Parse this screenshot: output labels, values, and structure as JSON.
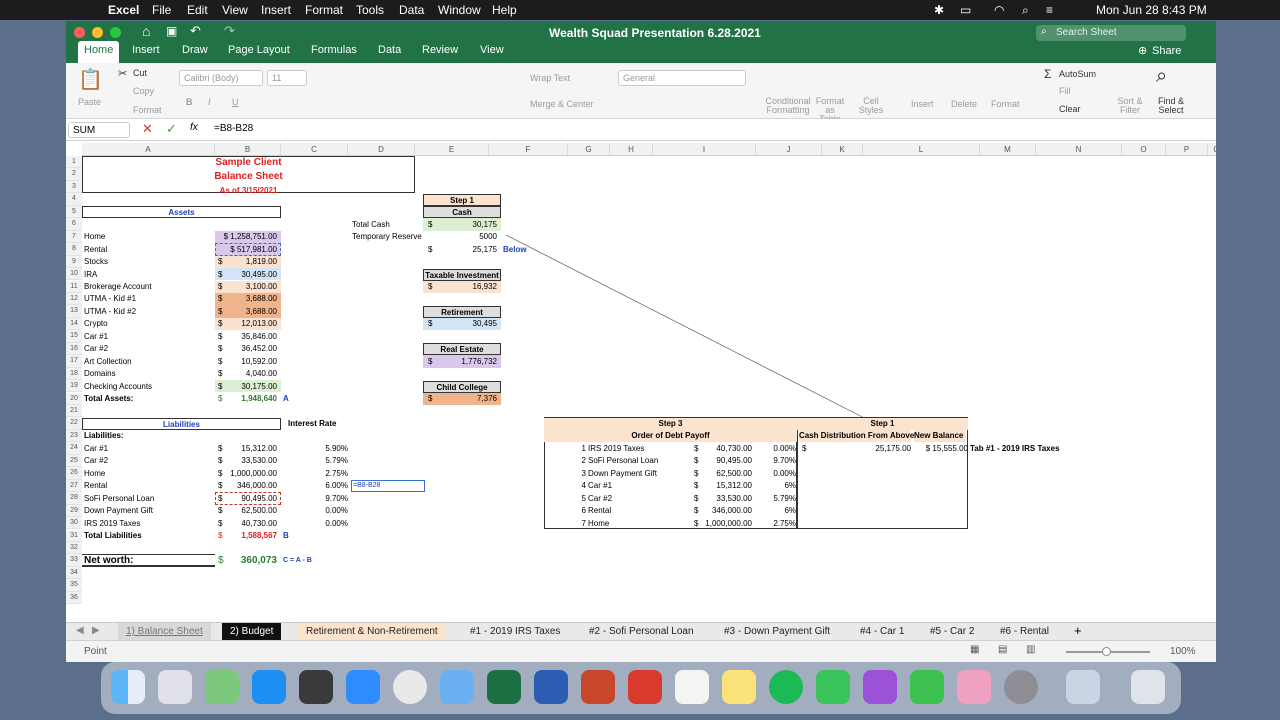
{
  "menubar": {
    "app": "Excel",
    "items": [
      "File",
      "Edit",
      "View",
      "Insert",
      "Format",
      "Tools",
      "Data",
      "Window",
      "Help"
    ],
    "clock": "Mon Jun 28  8:43 PM"
  },
  "window": {
    "title": "Wealth Squad Presentation 6.28.2021",
    "search_placeholder": "Search Sheet",
    "share": "Share"
  },
  "ribbon": {
    "tabs": [
      "Home",
      "Insert",
      "Draw",
      "Page Layout",
      "Formulas",
      "Data",
      "Review",
      "View"
    ],
    "paste": "Paste",
    "cut": "Cut",
    "copy": "Copy",
    "format": "Format",
    "font": "Calibri (Body)",
    "size": "11",
    "wrap": "Wrap Text",
    "merge": "Merge & Center",
    "numfmt": "General",
    "condfmt": "Conditional Formatting",
    "fmttable": "Format as Table",
    "cellstyles": "Cell Styles",
    "insert": "Insert",
    "delete": "Delete",
    "formatc": "Format",
    "autosum": "AutoSum",
    "fill": "Fill",
    "clear": "Clear",
    "sort": "Sort & Filter",
    "find": "Find & Select"
  },
  "formula": {
    "namebox": "SUM",
    "content": "=B8-B28"
  },
  "columns": [
    "A",
    "B",
    "C",
    "D",
    "E",
    "F",
    "G",
    "H",
    "I",
    "J",
    "K",
    "L",
    "M",
    "N",
    "O",
    "P",
    "Q"
  ],
  "header": {
    "line1": "Sample Client",
    "line2": "Balance Sheet",
    "line3": "As of 3/15/2021"
  },
  "assets_title": "Assets",
  "assets": [
    [
      "Home",
      "$ 1,258,751.00"
    ],
    [
      "Rental",
      "$   517,981.00"
    ],
    [
      "Stocks",
      "1,819.00"
    ],
    [
      "IRA",
      "30,495.00"
    ],
    [
      "Brokerage Account",
      "3,100.00"
    ],
    [
      "UTMA - Kid #1",
      "3,688.00"
    ],
    [
      "UTMA - Kid #2",
      "3,688.00"
    ],
    [
      "Crypto",
      "12,013.00"
    ],
    [
      "Car #1",
      "35,846.00"
    ],
    [
      "Car #2",
      "36,452.00"
    ],
    [
      "Art Collection",
      "10,592.00"
    ],
    [
      "Domains",
      "4,040.00"
    ],
    [
      "Checking Accounts",
      "30,175.00"
    ]
  ],
  "total_assets": {
    "label": "Total Assets:",
    "value": "1,948,640",
    "tag": "A"
  },
  "liab_title": "Liabilities",
  "interest_title": "Interest Rate",
  "liab_label": "Liabilities:",
  "liabilities": [
    [
      "Car #1",
      "15,312.00",
      "5.90%"
    ],
    [
      "Car #2",
      "33,530.00",
      "5.79%"
    ],
    [
      "Home",
      "1,000,000.00",
      "2.75%"
    ],
    [
      "Rental",
      "346,000.00",
      "6.00%"
    ],
    [
      "SoFi Personal Loan",
      "90,495.00",
      "9.70%"
    ],
    [
      "Down Payment Gift",
      "62,500.00",
      "0.00%"
    ],
    [
      "IRS 2019 Taxes",
      "40,730.00",
      "0.00%"
    ]
  ],
  "editing_cell": "=B8-B28",
  "total_liab": {
    "label": "Total Liabilities",
    "value": "1,588,567",
    "tag": "B"
  },
  "networth": {
    "label": "Net worth:",
    "value": "360,073",
    "tag": "C = A - B"
  },
  "cash": {
    "total_label": "Total Cash",
    "reserve_label": "Temporary Reserve",
    "step1": "Step 1",
    "cash": "Cash",
    "total": "30,175",
    "reserve": "5000",
    "remaining": "25,175",
    "below": "Below"
  },
  "boxes": [
    [
      "Taxable Investment",
      "16,932"
    ],
    [
      "Retirement",
      "30,495"
    ],
    [
      "Real Estate",
      "1,776,732"
    ],
    [
      "Child College",
      "7,376"
    ]
  ],
  "step3": {
    "title": "Step 3",
    "subtitle": "Order of Debt Payoff",
    "rows": [
      [
        "1",
        "IRS 2019 Taxes",
        "40,730.00",
        "0.00%"
      ],
      [
        "2",
        "SoFi Personal Loan",
        "90,495.00",
        "9.70%"
      ],
      [
        "3",
        "Down Payment Gift",
        "62,500.00",
        "0.00%"
      ],
      [
        "4",
        "Car #1",
        "15,312.00",
        "6%"
      ],
      [
        "5",
        "Car #2",
        "33,530.00",
        "5.79%"
      ],
      [
        "6",
        "Rental",
        "346,000.00",
        "6%"
      ],
      [
        "7",
        "Home",
        "1,000,000.00",
        "2.75%"
      ]
    ]
  },
  "step1b": {
    "title": "Step 1",
    "col1": "Cash Distribution From Above",
    "col2": "New Balance",
    "dist": "25,175.00",
    "newbal": "$ 15,555.00",
    "note": "Tab #1 - 2019 IRS Taxes"
  },
  "sheet_tabs": [
    "1) Balance Sheet",
    "2) Budget",
    "Retirement & Non-Retirement",
    "#1 - 2019 IRS Taxes",
    "#2 - Sofi Personal Loan",
    "#3 - Down Payment Gift",
    "#4 - Car 1",
    "#5 - Car 2",
    "#6 - Rental"
  ],
  "status": {
    "mode": "Point",
    "zoom": "100%"
  },
  "colors": {
    "excel_green": "#217346",
    "red": "#e02020",
    "green": "#2e7d32",
    "blue": "#1f3fbf"
  }
}
